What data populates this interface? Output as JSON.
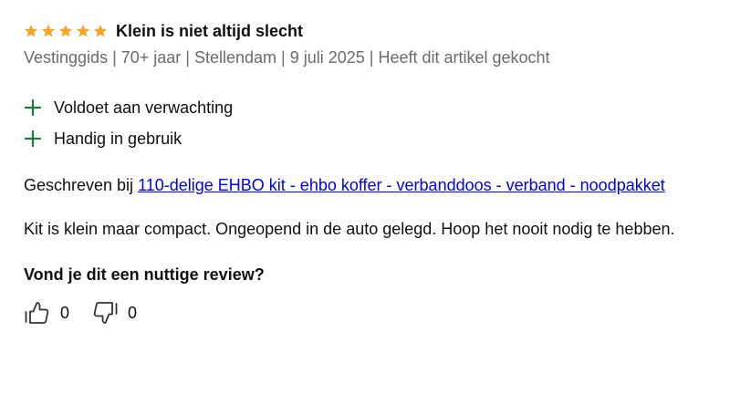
{
  "review": {
    "rating": 5,
    "rating_max": 5,
    "title": "Klein is niet altijd slecht",
    "meta": "Vestinggids | 70+ jaar | Stellendam | 9 juli 2025 | Heeft dit artikel gekocht",
    "pros": [
      "Voldoet aan verwachting",
      "Handig in gebruik"
    ],
    "written_prefix": "Geschreven bij ",
    "product_link": "110-delige EHBO kit - ehbo koffer - verbanddoos - verband - noodpakket",
    "text": "Kit is klein maar compact. Ongeopend in de auto gelegd. Hoop het nooit nodig te hebben.",
    "helpful_question": "Vond je dit een nuttige review?",
    "votes": {
      "up": "0",
      "down": "0"
    }
  },
  "colors": {
    "star": "#f5a623",
    "plus": "#1a7a3c",
    "meta": "#6b6b6b",
    "link": "#0000ee"
  },
  "icons": {
    "star": "star-icon",
    "plus": "plus-icon",
    "thumbs_up": "thumbs-up-icon",
    "thumbs_down": "thumbs-down-icon"
  }
}
